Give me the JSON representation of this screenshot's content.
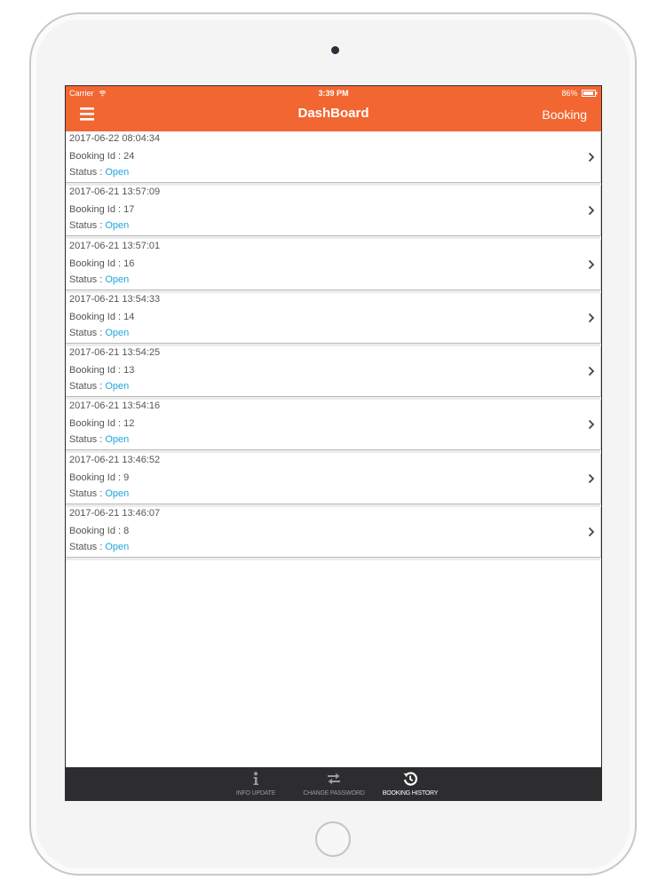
{
  "status_bar": {
    "carrier": "Carrier",
    "time": "3:39 PM",
    "battery": "86%"
  },
  "nav": {
    "title": "DashBoard",
    "right_button": "Booking",
    "menu_icon": "hamburger-menu-icon"
  },
  "colors": {
    "header": "#f26631",
    "status_open": "#1fa5df",
    "tab_bar": "#2d2d2f"
  },
  "bookings": [
    {
      "date": "2017-06-22 08:04:34",
      "id_label": "Booking Id : 24",
      "status_label": "Status : ",
      "status": "Open"
    },
    {
      "date": "2017-06-21 13:57:09",
      "id_label": "Booking Id : 17",
      "status_label": "Status : ",
      "status": "Open"
    },
    {
      "date": "2017-06-21 13:57:01",
      "id_label": "Booking Id : 16",
      "status_label": "Status : ",
      "status": "Open"
    },
    {
      "date": "2017-06-21 13:54:33",
      "id_label": "Booking Id : 14",
      "status_label": "Status : ",
      "status": "Open"
    },
    {
      "date": "2017-06-21 13:54:25",
      "id_label": "Booking Id : 13",
      "status_label": "Status : ",
      "status": "Open"
    },
    {
      "date": "2017-06-21 13:54:16",
      "id_label": "Booking Id : 12",
      "status_label": "Status : ",
      "status": "Open"
    },
    {
      "date": "2017-06-21 13:46:52",
      "id_label": "Booking Id : 9",
      "status_label": "Status : ",
      "status": "Open"
    },
    {
      "date": "2017-06-21 13:46:07",
      "id_label": "Booking Id : 8",
      "status_label": "Status : ",
      "status": "Open"
    }
  ],
  "tabs": [
    {
      "label": "INFO UPDATE",
      "icon": "info-icon",
      "active": false
    },
    {
      "label": "CHANGE PASSWORD",
      "icon": "swap-arrows-icon",
      "active": false
    },
    {
      "label": "BOOKING HISTORY",
      "icon": "history-icon",
      "active": true
    }
  ]
}
